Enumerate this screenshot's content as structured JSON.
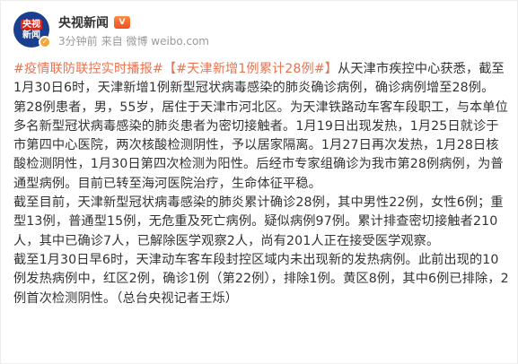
{
  "post": {
    "author": "央视新闻",
    "avatar_text_top": "央视",
    "avatar_text_bottom": "新闻",
    "vip_badge": "V",
    "time": "3分钟前",
    "source": "来自 微博 weibo.com",
    "topic1": "#疫情联防联控实时播报#",
    "topic2": "【#天津新增1例累计28例#】",
    "p1_rest": "从天津市疾控中心获悉，截至1月30日6时，天津新增1例新型冠状病毒感染的肺炎确诊病例，确诊病例增至28例。",
    "p2": "第28例患者，男，55岁，居住于天津市河北区。为天津铁路动车客车段职工，与本单位多名新型冠状病毒感染的肺炎患者为密切接触者。1月19日出现发热，1月25日就诊于市第四中心医院，两次核酸检测阴性，予以居家隔离。1月27日再次发热，1月28日核酸检测阴性，1月30日第四次检测为阳性。后经市专家组确诊为我市第28例病例，为普通型病例。目前已转至海河医院治疗，生命体征平稳。",
    "p3": "截至目前，天津新型冠状病毒感染的肺炎累计确诊28例，其中男性22例，女性6例；重型13例，普通型15例，无危重及死亡病例。疑似病例97例。累计排查密切接触者210人，其中已确诊7人，已解除医学观察2人，尚有201人正在接受医学观察。",
    "p4": "截至1月30日早6时，天津动车客车段封控区域内未出现新的发热病例。此前出现的10例发热病例中，红区2例，确诊1例（第22例），排除1例。黄区8例，其中6例已排除，2例首次检测阴性。（总台央视记者王烁）"
  }
}
